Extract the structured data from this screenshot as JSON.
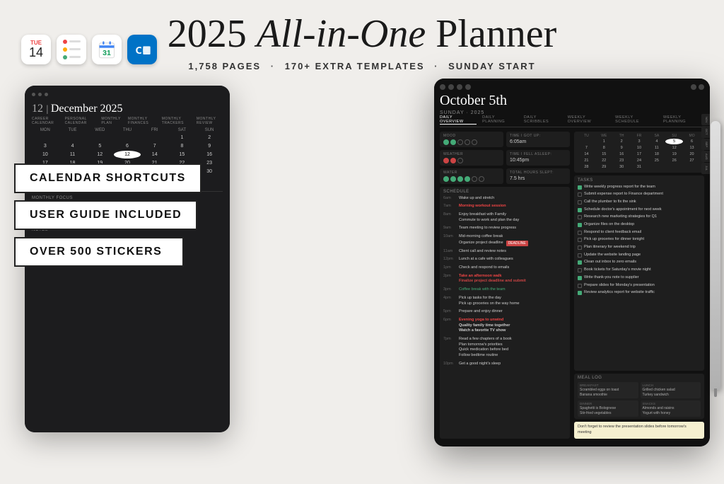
{
  "header": {
    "title_part1": "2025 ",
    "title_italic": "All-in-One",
    "title_part2": " Planner",
    "subtitle_pages": "1,758 PAGES",
    "subtitle_templates": "170+ EXTRA TEMPLATES",
    "subtitle_start": "SUNDAY START"
  },
  "features": {
    "badge1": "CALENDAR SHORTCUTS",
    "badge2": "USER GUIDE INCLUDED",
    "badge3": "OVER 500 STICKERS"
  },
  "app_icons": {
    "calendar_day": "TUE",
    "calendar_num": "14",
    "gcal_label": "Google Calendar",
    "outlook_label": "Outlook"
  },
  "left_tablet": {
    "date": "12 | December 2025",
    "days": [
      "MON",
      "TUE",
      "WED",
      "THU",
      "FRI",
      "SAT",
      "SUN"
    ],
    "section_label": "MONTHLY FOCUS",
    "notes_label": "NOTES"
  },
  "right_tablet": {
    "date": "October 5th",
    "day_info": "SUNDAY · 2025",
    "tabs": [
      "DAILY OVERVIEW",
      "DAILY PLANNING",
      "DAILY SCRIBBLES",
      "WEEKLY OVERVIEW",
      "WEEKLY SCHEDULE",
      "WEEKLY PLANNING"
    ],
    "trackers": {
      "mood_label": "MOOD",
      "weather_label": "WEATHER",
      "water_label": "WATER",
      "sleep_label": "TIME I GOT UP:",
      "sleep_time": "6:05am",
      "fell_asleep_label": "TIME I FELL ASLEEP:",
      "fell_asleep_time": "10:45pm",
      "hours_label": "TOTAL HOURS SLEPT:",
      "hours_value": "7.5 hrs"
    },
    "schedule_items": [
      {
        "time": "6am",
        "event": "Wake up and stretch"
      },
      {
        "time": "7am",
        "event": "Morning workout session",
        "highlight": true
      },
      {
        "time": "8am",
        "event": "Enjoy breakfast with family\nCommute to work and plan the day"
      },
      {
        "time": "9am",
        "event": "Team meeting to review progress"
      },
      {
        "time": "10am",
        "event": "Mid-morning coffee break\nOrganize project deadline",
        "badge": "DEADLINE"
      },
      {
        "time": "11am",
        "event": "Client call and review notes"
      },
      {
        "time": "12pm",
        "event": "Lunch at a cafe with colleagues"
      },
      {
        "time": "1pm",
        "event": "Check and respond to emails"
      },
      {
        "time": "2pm",
        "event": "Take an afternoon walk\nFinalize project deadline and submit"
      },
      {
        "time": "3pm",
        "event": "Coffee break with the team",
        "highlight": true
      },
      {
        "time": "4pm",
        "event": "Pick up tasks for the day\nPick up groceries on the way home"
      },
      {
        "time": "5pm",
        "event": "Prepare and enjoy dinner"
      },
      {
        "time": "6pm",
        "event": "Evening yoga to unwind\nQuality family time together\nWatch a favorite TV show"
      },
      {
        "time": "7pm",
        "event": "Read a few chapters of a book\nPlan tomorrow's priorities\nQuick medication before bed\nFollow bedtime routine"
      },
      {
        "time": "10pm",
        "event": "Get a good night's sleep"
      }
    ],
    "tasks": [
      {
        "text": "Write weekly progress report for the team",
        "done": true
      },
      {
        "text": "Submit expense report to Finance department",
        "done": false
      },
      {
        "text": "Call the plumber to fix the sink",
        "done": false
      },
      {
        "text": "Schedule doctor's appointment for next week",
        "done": true
      },
      {
        "text": "Research new marketing strategies for Q1",
        "done": false
      },
      {
        "text": "Organize files on the desktop",
        "done": true
      },
      {
        "text": "Respond to client feedback email",
        "done": false
      },
      {
        "text": "Pick up groceries for dinner tonight",
        "done": false
      },
      {
        "text": "Plan itinerary for weekend trip",
        "done": false
      },
      {
        "text": "Update the website landing page",
        "done": false
      },
      {
        "text": "Clean out inbox to zero emails",
        "done": true
      },
      {
        "text": "Book tickets for Saturday's movie night",
        "done": false
      },
      {
        "text": "Write thank-you note to supplier",
        "done": true
      },
      {
        "text": "Prepare slides for Monday's presentation",
        "done": false
      },
      {
        "text": "Review analytics report for website traffic",
        "done": true
      }
    ],
    "meals": {
      "breakfast": "Scrambled eggs on toast\nBanana smoothie",
      "lunch": "Grilled chicken salad\nTurkey sandwich",
      "dinner": "Spaghetti is Bolognese\nStir-fried vegetables",
      "snacks": "Almonds and raisins\nYogurt with honey"
    },
    "notes": "Don't forget to review the presentation slides before tomorrow's meeting",
    "side_tabs": [
      "NOV",
      "OCT",
      "SEP",
      "AUG",
      "JUL"
    ]
  }
}
